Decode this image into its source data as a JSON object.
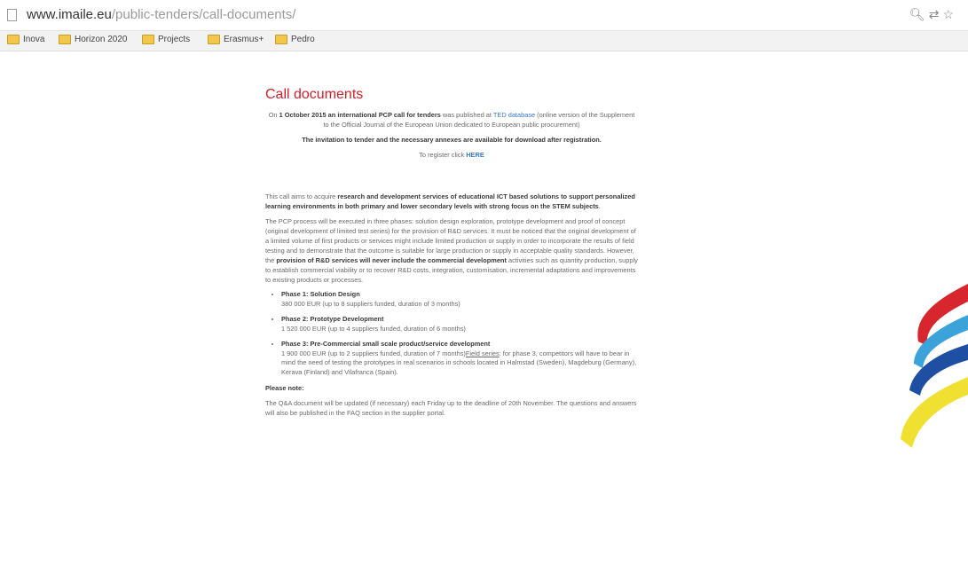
{
  "browser": {
    "url_domain": "www.imaile.eu",
    "url_path": "/public-tenders/call-documents/",
    "bookmarks": [
      "Inova",
      "Horizon 2020",
      "Projects",
      "Erasmus+",
      "Pedro"
    ]
  },
  "page": {
    "title": "Call documents",
    "intro": {
      "p1_a": "On ",
      "p1_bold": "1 October 2015 an international PCP call for tenders",
      "p1_b": " was published at ",
      "p1_link": "TED database",
      "p1_c": " (online version of the Supplement to the Official Journal of the European Union dedicated to European public procurement)",
      "p2": "The invitation to tender and the necessary annexes are available for download after registration.",
      "p3_a": "To register click ",
      "p3_link": "HERE"
    },
    "aim_a": "This call aims to acquire ",
    "aim_bold": "research and development services of educational ICT based solutions to support personalized learning environments in both primary and lower secondary levels with strong focus on the STEM subjects",
    "aim_b": ".",
    "pcp_a": "The PCP process will be executed in three phases: solution design exploration, prototype development and proof of concept (original development of limited test series) for the provision of R&D services. It must be noticed that the original development of a limited volume of first products or services might include limited production or supply in order to incorporate the results of field testing and to demonstrate that the outcome is suitable for large production or supply in acceptable quality standards. However, the ",
    "pcp_bold": "provision of R&D services will never include the commercial development",
    "pcp_b": " activities such as quantity production, supply to establish commercial viability or to recover R&D costs, integration, customisation, incremental adaptations and improvements to existing products or processes.",
    "phases": [
      {
        "title": "Phase 1: Solution Design",
        "detail": "380 000 EUR (up to 8 suppliers funded, duration of 3 months)"
      },
      {
        "title": "Phase 2: Prototype Development",
        "detail": "1 520 000 EUR (up to 4 suppliers funded, duration of 6 months)"
      },
      {
        "title": "Phase 3: Pre-Commercial small scale product/service development",
        "detail_a": "1 900 000 EUR (up to 2 suppliers funded, duration of 7 months)",
        "detail_link": "Field series",
        "detail_b": ": for phase 3, competitors will have to bear in mind the need of testing the prototypes in real scenarios in schools located in Halmstad (Sweden), Magdeburg (Germany), Kerava (Finland) and Vilafranca (Spain)."
      }
    ],
    "note_label": "Please note:",
    "note_text": "The Q&A document will be updated (if necessary) each Friday up to the deadline of 20th November. The questions and answers will also be published in the FAQ section in the supplier portal."
  },
  "colors": {
    "title": "#d0202a",
    "link": "#3a7bd5"
  },
  "icons": [
    "page-icon",
    "zoom-icon",
    "translate-icon",
    "star-icon",
    "folder-icon"
  ]
}
